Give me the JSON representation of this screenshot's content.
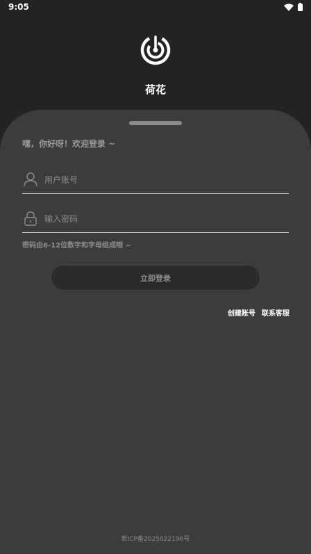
{
  "status": {
    "time": "9:05"
  },
  "app": {
    "name": "荷花"
  },
  "login": {
    "greeting": "嘿，你好呀！欢迎登录 ~",
    "account_placeholder": "用户账号",
    "password_placeholder": "输入密码",
    "password_hint": "密码由6-12位数字和字母组成哦 ~",
    "login_button": "立即登录",
    "create_account": "创建账号",
    "contact_service": "联系客服"
  },
  "footer": {
    "icp": "新ICP备2025022196号"
  }
}
